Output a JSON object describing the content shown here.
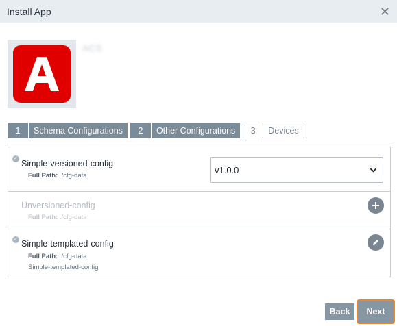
{
  "dialog": {
    "title": "Install App",
    "close_icon": "close-icon"
  },
  "app": {
    "name": "ACS",
    "logo_letter": "A",
    "logo_color": "#e00000"
  },
  "steps": [
    {
      "number": "1",
      "label": "Schema Configurations",
      "state": "done"
    },
    {
      "number": "2",
      "label": "Other Configurations",
      "state": "done"
    },
    {
      "number": "3",
      "label": "Devices",
      "state": "pending"
    }
  ],
  "configs": [
    {
      "name": "Simple-versioned-config",
      "path_label": "Full Path:",
      "path": "./cfg-data",
      "checked": true,
      "version": "v1.0.0"
    },
    {
      "name": "Unversioned-config",
      "path_label": "Full Path:",
      "path": "./cfg-data",
      "checked": false
    },
    {
      "name": "Simple-templated-config",
      "path_label": "Full Path:",
      "path": "./cfg-data",
      "template": "Simple-templated-config",
      "checked": true
    }
  ],
  "footer": {
    "back_label": "Back",
    "next_label": "Next",
    "accent": "#e8882c"
  }
}
